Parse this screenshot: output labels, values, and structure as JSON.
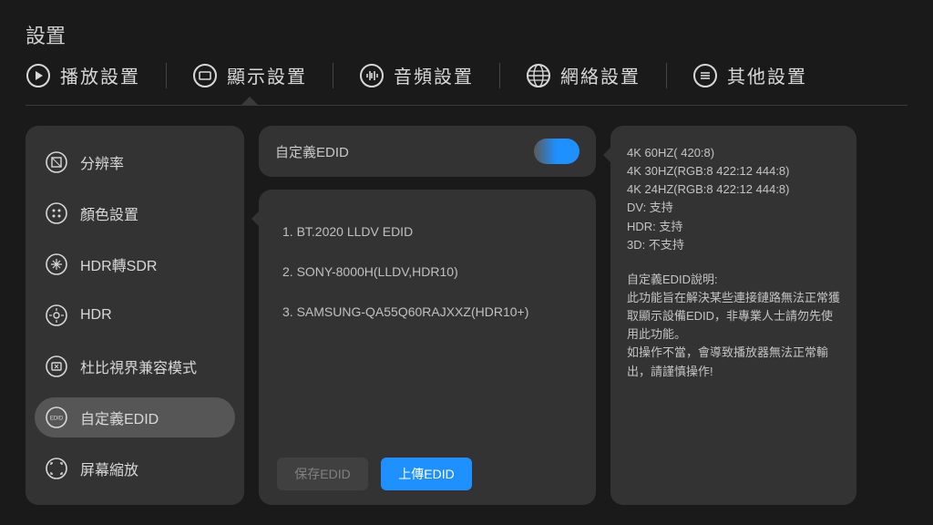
{
  "title": "設置",
  "tabs": {
    "playback": "播放設置",
    "display": "顯示設置",
    "audio": "音頻設置",
    "network": "網絡設置",
    "other": "其他設置"
  },
  "sidebar": {
    "resolution": "分辨率",
    "color": "顏色設置",
    "hdr2sdr": "HDR轉SDR",
    "hdr": "HDR",
    "dolby": "杜比視界兼容模式",
    "custom_edid": "自定義EDID",
    "zoom": "屏幕縮放"
  },
  "center": {
    "toggle_label": "自定義EDID",
    "items": [
      "1. BT.2020 LLDV EDID",
      "2. SONY-8000H(LLDV,HDR10)",
      "3. SAMSUNG-QA55Q60RAJXXZ(HDR10+)"
    ],
    "save_btn": "保存EDID",
    "upload_btn": "上傳EDID"
  },
  "info": {
    "caps": [
      "4K 60HZ( 420:8)",
      "4K 30HZ(RGB:8 422:12 444:8)",
      "4K 24HZ(RGB:8 422:12 444:8)",
      "DV: 支持",
      "HDR: 支持",
      "3D: 不支持"
    ],
    "body_title": "自定義EDID說明:",
    "body": "此功能旨在解決某些連接鏈路無法正常獲取顯示設備EDID，非專業人士請勿先使用此功能。\n如操作不當，會導致播放器無法正常輸出，請謹慎操作!"
  }
}
